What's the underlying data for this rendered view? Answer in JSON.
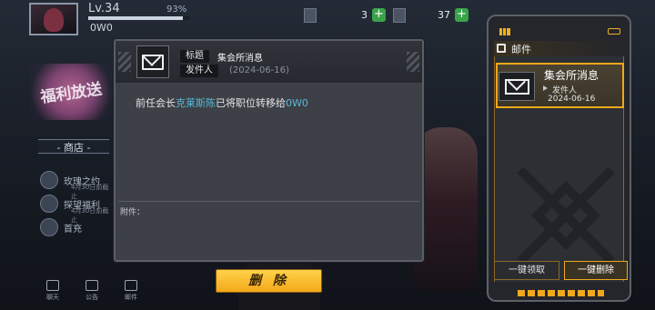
{
  "player": {
    "level": "Lv.34",
    "exp_percent": "93%",
    "exp_fraction": 0.93,
    "name": "0W0"
  },
  "resources": [
    {
      "icon": "card-icon",
      "value": "3"
    },
    {
      "icon": "gem-icon",
      "value": "37"
    }
  ],
  "side_menu": {
    "promo_text": "福利放送",
    "shop_label": "- 商店 -",
    "items": [
      {
        "label": "玫瑰之约",
        "sub": "4月30日前截止"
      },
      {
        "label": "探望福利",
        "sub": "4月30日前截止"
      },
      {
        "label": "首充",
        "sub": ""
      }
    ]
  },
  "bottom_nav": [
    {
      "label": "聊天",
      "icon": "chat-icon"
    },
    {
      "label": "公告",
      "icon": "announcement-icon"
    },
    {
      "label": "邮件",
      "icon": "mail-icon"
    }
  ],
  "message": {
    "title_tag": "标题",
    "title": "集会所消息",
    "sender_tag": "发件人",
    "date": "(2024-06-16)",
    "body_prefix": "前任会长",
    "body_name": "克莱斯陈",
    "body_mid": "已将职位转移给",
    "body_target": "0W0",
    "attachments_label": "附件："
  },
  "delete_button": "删 除",
  "mail_panel": {
    "title": "邮件",
    "items": [
      {
        "title": "集会所消息",
        "sender": "发件人",
        "date": "2024-06-16",
        "selected": true
      }
    ],
    "claim_all": "一键领取",
    "delete_all": "一键删除"
  },
  "colors": {
    "accent": "#f0a81c",
    "highlight": "#58b8d8",
    "plus_button": "#3aa34a"
  }
}
